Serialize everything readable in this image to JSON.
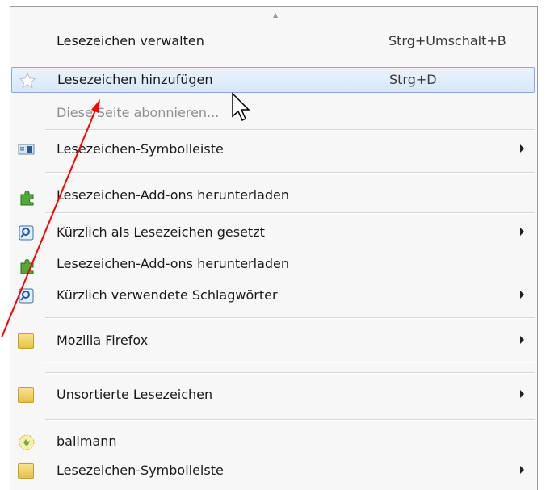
{
  "menu": {
    "items": [
      {
        "label": "Lesezeichen verwalten",
        "shortcut": "Strg+Umschalt+B",
        "icon": "none"
      },
      {
        "label": "Lesezeichen hinzufügen",
        "shortcut": "Strg+D",
        "icon": "star-icon"
      },
      {
        "label": "Diese Seite abonnieren...",
        "icon": "none"
      },
      {
        "label": "Lesezeichen-Symbolleiste",
        "icon": "toolbar-icon"
      },
      {
        "label": "Lesezeichen-Add-ons herunterladen",
        "icon": "puzzle-icon"
      },
      {
        "label": "Kürzlich als Lesezeichen gesetzt",
        "icon": "search-folder-icon"
      },
      {
        "label": "Lesezeichen-Add-ons herunterladen",
        "icon": "puzzle-icon"
      },
      {
        "label": "Kürzlich verwendete Schlagwörter",
        "icon": "search-folder-icon"
      },
      {
        "label": "Mozilla Firefox",
        "icon": "folder-icon"
      },
      {
        "label": "Unsortierte Lesezeichen",
        "icon": "folder-icon"
      },
      {
        "label": "ballmann",
        "icon": "globe-icon"
      },
      {
        "label": "Lesezeichen-Symbolleiste",
        "icon": "folder-icon"
      }
    ]
  },
  "colors": {
    "highlight_border": "#84acdd",
    "annotation_arrow": "#ff0000"
  }
}
